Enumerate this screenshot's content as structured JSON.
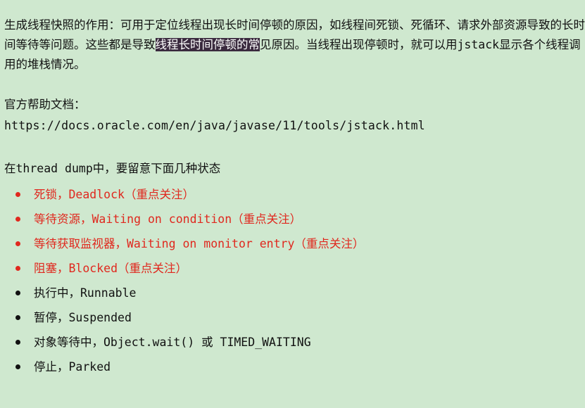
{
  "intro": {
    "before": "生成线程快照的作用：可用于定位线程出现长时间停顿的原因，如线程间死锁、死循环、请求外部资源导致的长时间等待等问题。这些都是导致",
    "highlight": "线程长时间停顿的常",
    "after": "见原因。当线程出现停顿时，就可以用jstack显示各个线程调用的堆栈情况。"
  },
  "docs": {
    "label": "官方帮助文档：",
    "url": "https://docs.oracle.com/en/java/javase/11/tools/jstack.html"
  },
  "states_title": "在thread dump中，要留意下面几种状态",
  "states": [
    {
      "text": "死锁，Deadlock（重点关注）",
      "important": true
    },
    {
      "text": "等待资源，Waiting on condition（重点关注）",
      "important": true
    },
    {
      "text": "等待获取监视器，Waiting on monitor entry（重点关注）",
      "important": true
    },
    {
      "text": "阻塞，Blocked（重点关注）",
      "important": true
    },
    {
      "text": "执行中，Runnable",
      "important": false
    },
    {
      "text": "暂停，Suspended",
      "important": false
    },
    {
      "text": "对象等待中，Object.wait() 或 TIMED_WAITING",
      "important": false
    },
    {
      "text": "停止，Parked",
      "important": false
    }
  ],
  "colors": {
    "background": "#cfe8cf",
    "important": "#e0281e",
    "highlight_bg": "#3a2a3e"
  }
}
